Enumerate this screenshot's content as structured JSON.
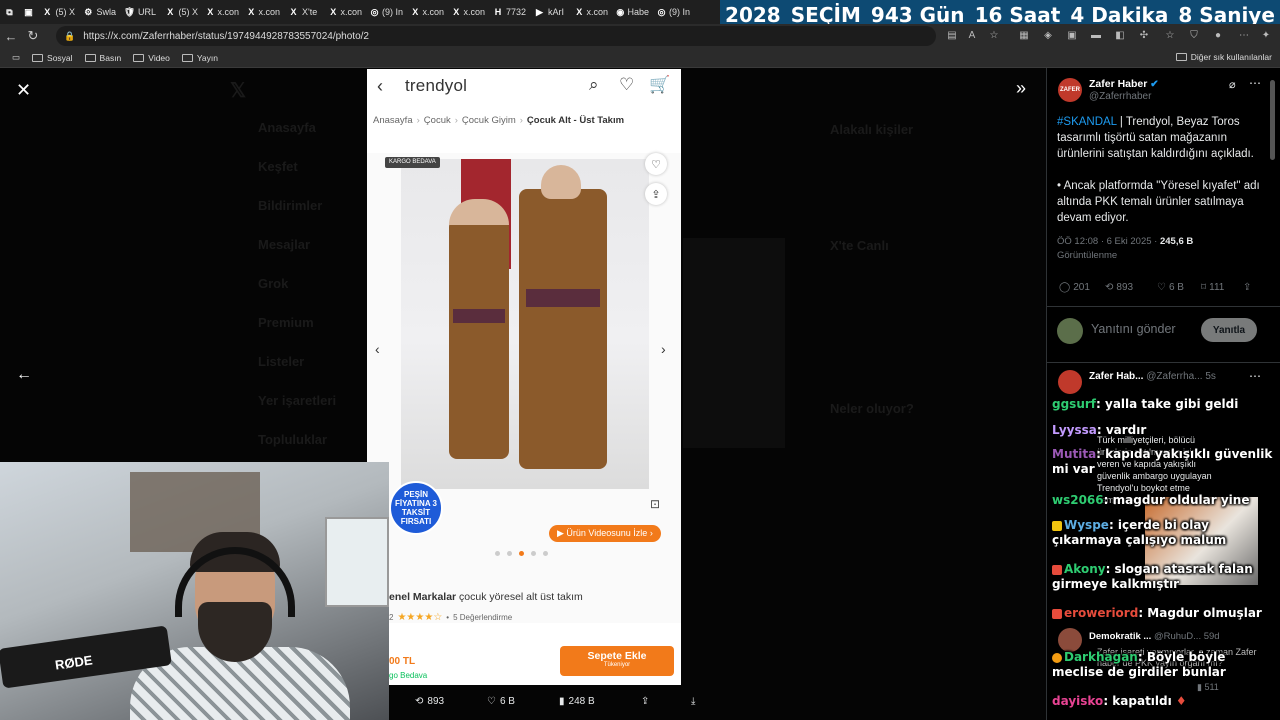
{
  "browser": {
    "tabs": [
      {
        "label": "",
        "icon": "X"
      },
      {
        "label": "(5) X",
        "icon": "X"
      },
      {
        "label": "Swla",
        "icon": "⚙"
      },
      {
        "label": "URL",
        "icon": "🛡"
      },
      {
        "label": "(5) X",
        "icon": "X"
      },
      {
        "label": "x.con",
        "icon": "X"
      },
      {
        "label": "x.con",
        "icon": "X"
      },
      {
        "label": "X'te",
        "icon": "X"
      },
      {
        "label": "x.con",
        "icon": "X"
      },
      {
        "label": "(9) In",
        "icon": "◎"
      },
      {
        "label": "x.con",
        "icon": "X"
      },
      {
        "label": "x.con",
        "icon": "X"
      },
      {
        "label": "7732",
        "icon": "H"
      },
      {
        "label": "kArI",
        "icon": "▶"
      },
      {
        "label": "x.con",
        "icon": "X"
      },
      {
        "label": "Habe",
        "icon": "◉"
      },
      {
        "label": "(9) In",
        "icon": "◎"
      }
    ],
    "url": "https://x.com/Zaferrhaber/status/1974944928783557024/photo/2",
    "bookmarks": [
      "Sosyal",
      "Basın",
      "Video",
      "Yayın"
    ],
    "bookmarks_other": "Diğer sık kullanılanlar"
  },
  "countdown": {
    "year": "2028",
    "label": "SEÇİM",
    "days": "943 Gün",
    "hours": "16 Saat",
    "minutes": "4 Dakika",
    "seconds": "8 Saniye",
    "bg_color": "#0d4a73"
  },
  "x_background": {
    "nav": [
      "Anasayfa",
      "Keşfet",
      "Bildirimler",
      "Mesajlar",
      "Grok",
      "Premium",
      "Listeler",
      "Yer işaretleri",
      "Topluluklar"
    ],
    "side_heads": [
      "Alakalı kişiler",
      "X'te Canlı",
      "Neler oluyor?"
    ]
  },
  "trendyol": {
    "logo": "trendyol",
    "breadcrumb": [
      "Anasayfa",
      "Çocuk",
      "Çocuk Giyim",
      "Çocuk Alt - Üst Takım"
    ],
    "kargo_badge": "KARGO BEDAVA",
    "pesin_badge": "PEŞİN FİYATINA 3 TAKSİT FIRSATI",
    "video_button": "Ürün Videosunu İzle",
    "brand": "enel Markalar",
    "product": "çocuk yöresel alt üst takım",
    "rating_value": "2",
    "rating_stars": 4,
    "reviews": "5 Değerlendirme",
    "price": "00 TL",
    "kargo_text": "go Bedava",
    "add_to_cart": "Sepete Ekle",
    "add_to_cart_sub": "Tükeniyor",
    "accent_color": "#f27a1a",
    "carousel_active": 3,
    "carousel_count": 5
  },
  "photo_actions": {
    "retweets": "893",
    "likes": "6 B",
    "views": "248 B"
  },
  "tweet": {
    "author": "Zafer Haber",
    "handle": "@Zaferrhaber",
    "hashtag": "#SKANDAL",
    "text1": " | Trendyol, Beyaz Toros tasarımlı tişörtü satan mağazanın ürünlerini satıştan kaldırdığını açıkladı.",
    "text2": "• Ancak platformda \"Yöresel kıyafet\" adı altında PKK temalı ürünler satılmaya devam ediyor.",
    "time": "ÖÖ 12:08 · 6 Eki 2025 · ",
    "views_count": "245,6 B",
    "views_label": "Görüntülenme",
    "replies": "201",
    "retweets": "893",
    "likes": "6 B",
    "bookmarks": "111",
    "reply_placeholder": "Yanıtını gönder",
    "reply_button": "Yanıtla"
  },
  "reply1": {
    "author": "Zafer Hab...",
    "handle": "@Zaferrha...",
    "age": "5s",
    "body": "Türk milliyetçileri, bölücü ürünlerin satılmasına izin veren ve kapıda yakışıklı güvenlik ambargo uygulayan Trendyol'u boykot etme kampanyası ..."
  },
  "reply2": {
    "author": "Demokratik ...",
    "handle": "@RuhuD...",
    "age": "59d",
    "body": "Zafer işareti yapmıyorlar, o zaman Zafer haber de PKK yayın organı mı?",
    "views": "511"
  },
  "chat": [
    {
      "user": "ggsurf",
      "color": "#2ecc71",
      "msg": "yalla take gibi geldi"
    },
    {
      "user": "Lyyssa",
      "color": "#c39bff",
      "msg": "vardır"
    },
    {
      "user": "Mutita",
      "color": "#9b59b6",
      "msg": "kapıda yakışıklı güvenlik mi var"
    },
    {
      "user": "ws2066",
      "color": "#2ecc71",
      "msg": "magdur oldular yine"
    },
    {
      "user": "Wyspe",
      "color": "#5dade2",
      "msg": "içerde bi olay çıkarmaya çalışıyo malum"
    },
    {
      "user": "Akony",
      "color": "#2ecc71",
      "msg": "slogan atasrak falan girmeye kalkmıştır"
    },
    {
      "user": "eroweriord",
      "color": "#e74c3c",
      "msg": "Magdur olmuşlar"
    },
    {
      "user": "Darkhagan",
      "color": "#2ecc71",
      "msg": "Böyle böyle meclise de girdiler bunlar"
    },
    {
      "user": "dayisko",
      "color": "#e84393",
      "msg": "kapatıldı"
    }
  ],
  "webcam": {
    "mic_brand": "RØDE"
  }
}
